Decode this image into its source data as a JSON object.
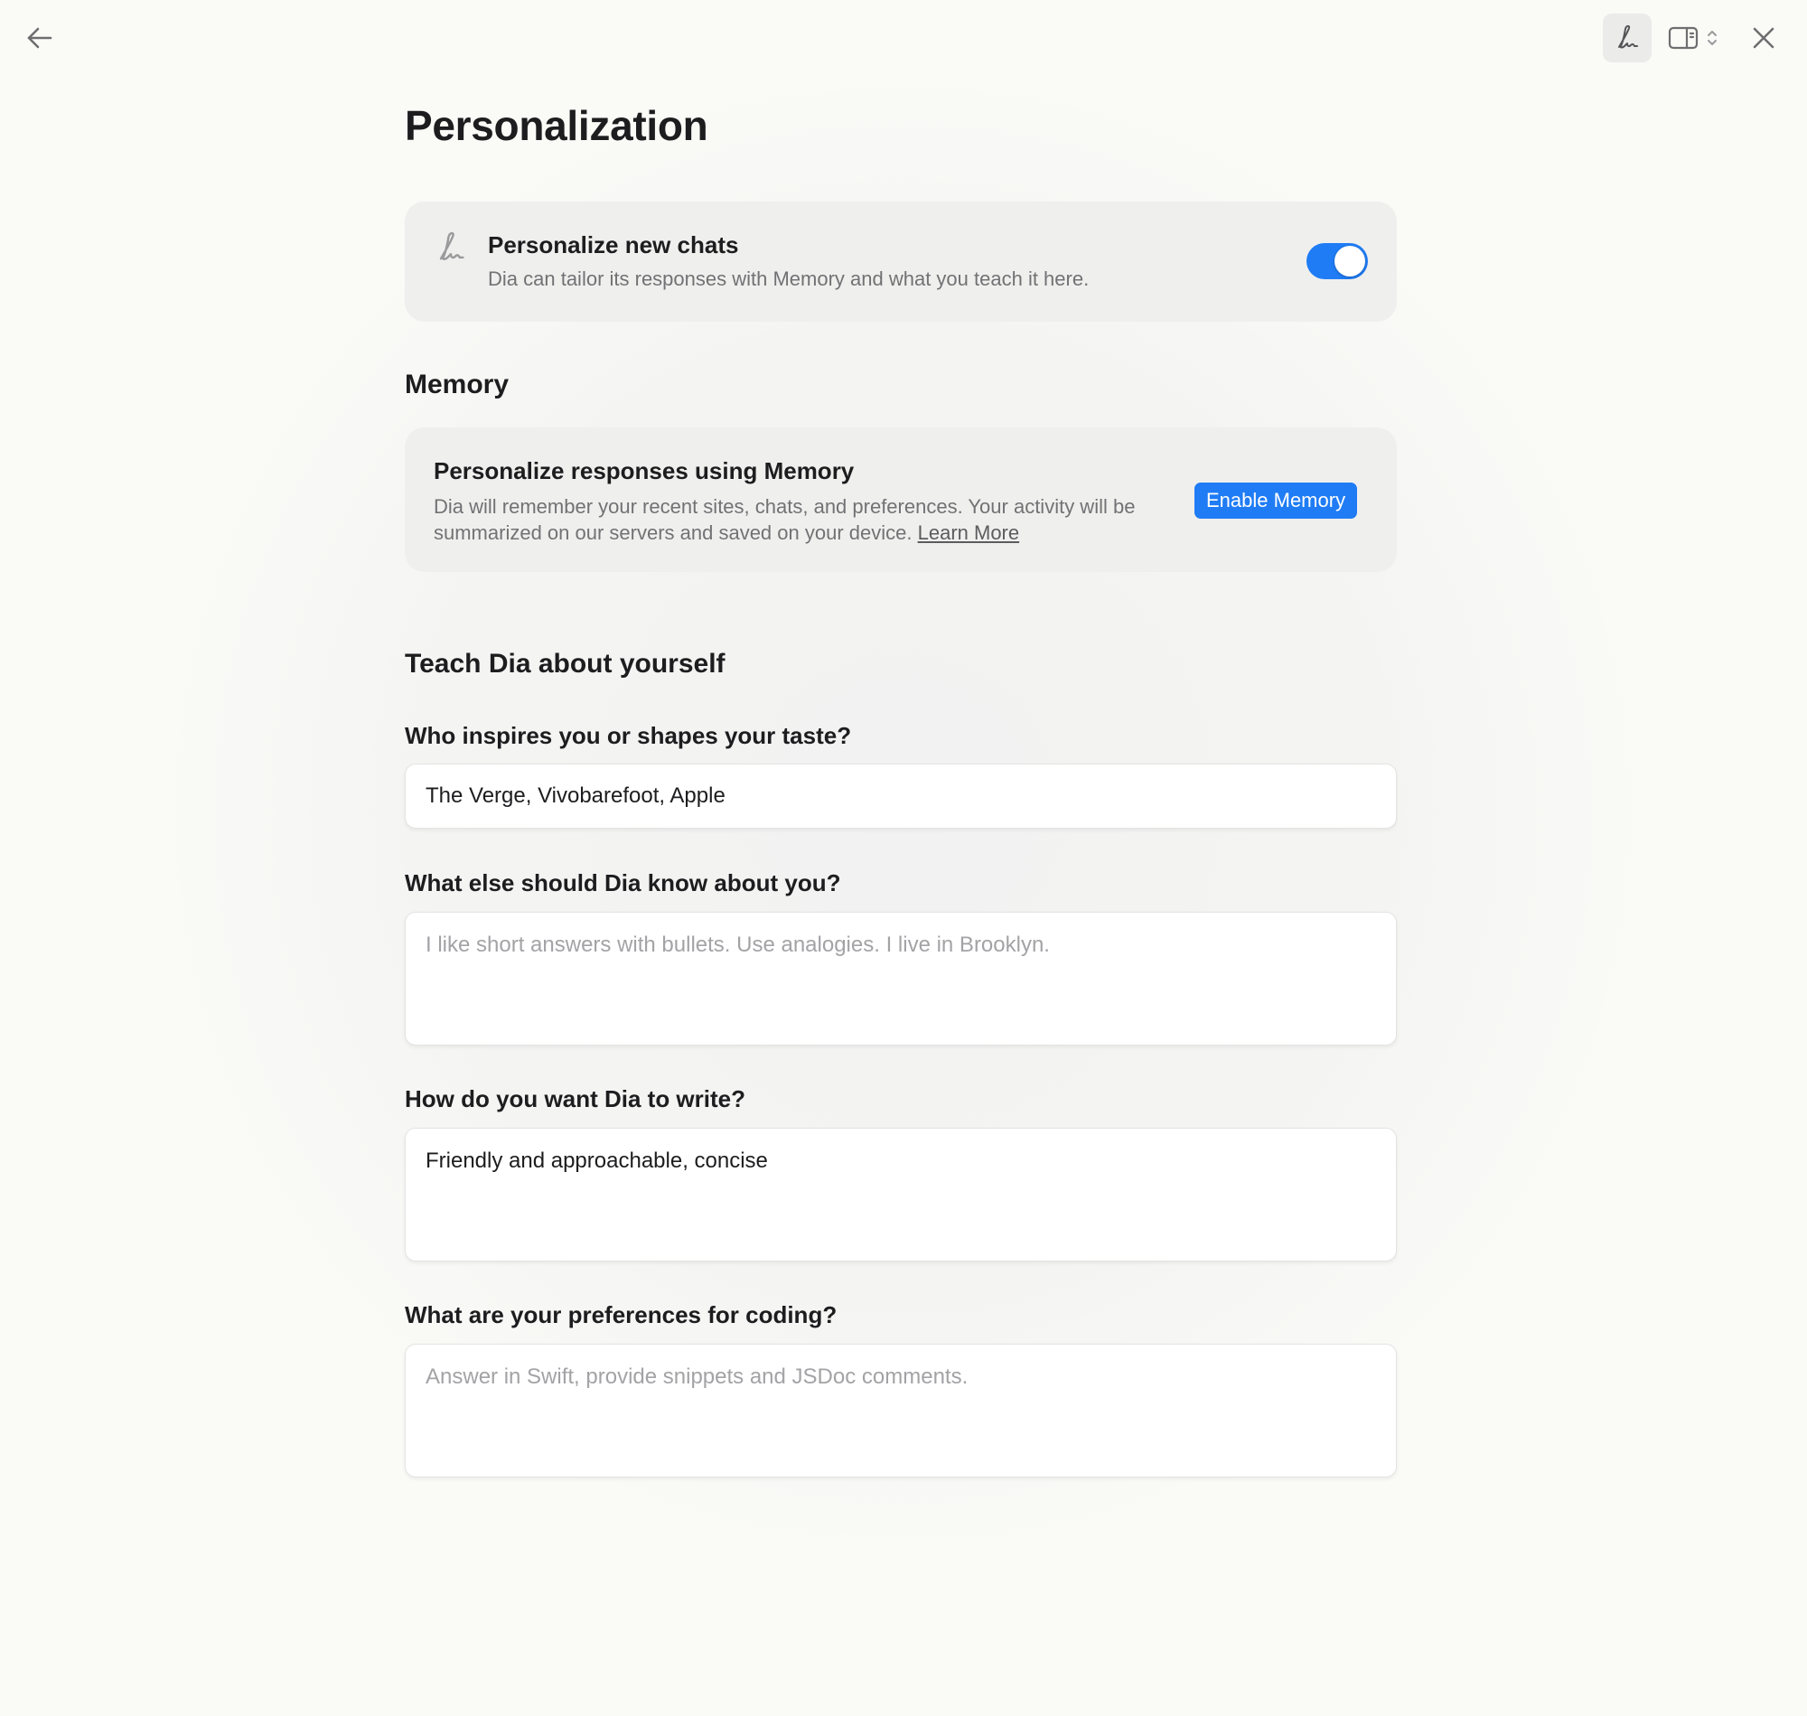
{
  "title": "Personalization",
  "toolbar": {
    "back_icon": "arrow-left-icon",
    "personalize_icon": "signature-pen-icon",
    "panel_icon": "sidebar-panel-icon",
    "close_icon": "close-icon"
  },
  "personalize_chats": {
    "title": "Personalize new chats",
    "description": "Dia can tailor its responses with Memory and what you teach it here.",
    "enabled": true
  },
  "memory": {
    "heading": "Memory",
    "title": "Personalize responses using Memory",
    "description": "Dia will remember your recent sites, chats, and preferences. Your activity will be summarized on our servers and saved on your device.",
    "learn_more": "Learn More",
    "enable_button": "Enable Memory"
  },
  "teach": {
    "heading": "Teach Dia about yourself",
    "questions": [
      {
        "label": "Who inspires you or shapes your taste?",
        "value": "The Verge, Vivobarefoot, Apple",
        "placeholder": ""
      },
      {
        "label": "What else should Dia know about you?",
        "value": "",
        "placeholder": "I like short answers with bullets. Use analogies. I live in Brooklyn."
      },
      {
        "label": "How do you want Dia to write?",
        "value": "Friendly and approachable, concise",
        "placeholder": ""
      },
      {
        "label": "What are your preferences for coding?",
        "value": "",
        "placeholder": "Answer in Swift, provide snippets and JSDoc comments."
      }
    ]
  },
  "colors": {
    "accent": "#1f7cf5",
    "background": "#fafaf7",
    "card": "#efefee"
  }
}
